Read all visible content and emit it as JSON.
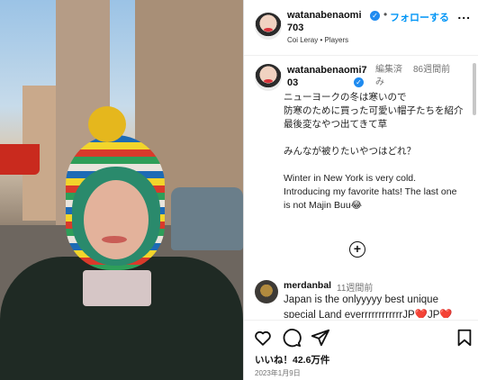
{
  "post": {
    "author": "watanabenaomi703",
    "verified_icon": "verified-badge-icon",
    "separator": "•",
    "follow_label": "フォローする",
    "more_label": "...",
    "music": "Coi Leray • Players"
  },
  "caption": {
    "author": "watanabenaomi703",
    "edited": "編集済み",
    "time": "86週間前",
    "text": "ニューヨークの冬は寒いので\n防寒のために買った可愛い帽子たちを紹介\n最後変なやつ出てきて草\n\nみんなが被りたいやつはどれ？\n\nWinter in New York is very cold.\nIntroducing my favorite hats! The last one is not Majin Buu😂"
  },
  "load_more_icon": "plus-circle-icon",
  "comments": [
    {
      "user": "merdanbal",
      "time": "11週間前",
      "text": "Japan is the onlyyyyy best unique special Land everrrrrrrrrrrrJP❤️JP❤️"
    }
  ],
  "actions": {
    "like_icon": "heart-icon",
    "comment_icon": "comment-icon",
    "share_icon": "share-icon",
    "save_icon": "bookmark-icon"
  },
  "likes_text": "いいね！42.6万件",
  "date_text": "2023年1月9日",
  "colors": {
    "accent": "#0095f6",
    "verified": "#1f8bf0",
    "muted": "#737373"
  }
}
